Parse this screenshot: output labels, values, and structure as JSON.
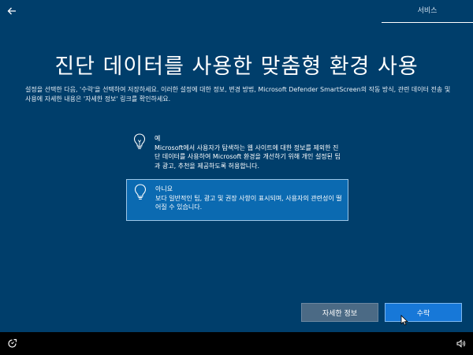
{
  "header": {
    "back_icon": "back-arrow-icon",
    "section_label": "서비스"
  },
  "title": "진단 데이터를 사용한 맞춤형 환경 사용",
  "description": "설정을 선택한 다음, '수락'을 선택하여 저장하세요. 이러한 설정에 대한 정보, 변경 방법, Microsoft Defender SmartScreen의 작동 방식, 관련 데이터 전송 및 사용에 자세한 내용은 '자세한 정보' 링크를 확인하세요.",
  "options": [
    {
      "icon": "lightbulb-icon",
      "title": "예",
      "body": "Microsoft에서 사용자가 탐색하는 웹 사이트에 대한 정보를 제외한 진단 데이터를 사용하여 Microsoft 환경을 개선하기 위해 개인 설정된 팁과 광고, 추천을 제공하도록 허용합니다.",
      "selected": false
    },
    {
      "icon": "lightbulb-icon",
      "title": "아니요",
      "body": "보다 일반적인 팁, 광고 및 권장 사항이 표시되며, 사용자의 관련성이 떨어질 수 있습니다.",
      "selected": true
    }
  ],
  "buttons": {
    "more_info": "자세한 정보",
    "accept": "수락"
  },
  "taskbar": {
    "left_icon": "ease-of-access-icon",
    "right_icon": "volume-icon"
  },
  "colors": {
    "background": "#003e6b",
    "selected_option": "#0b6ab1",
    "accept_button": "#1778d8",
    "more_info_button": "#4b6a85"
  }
}
